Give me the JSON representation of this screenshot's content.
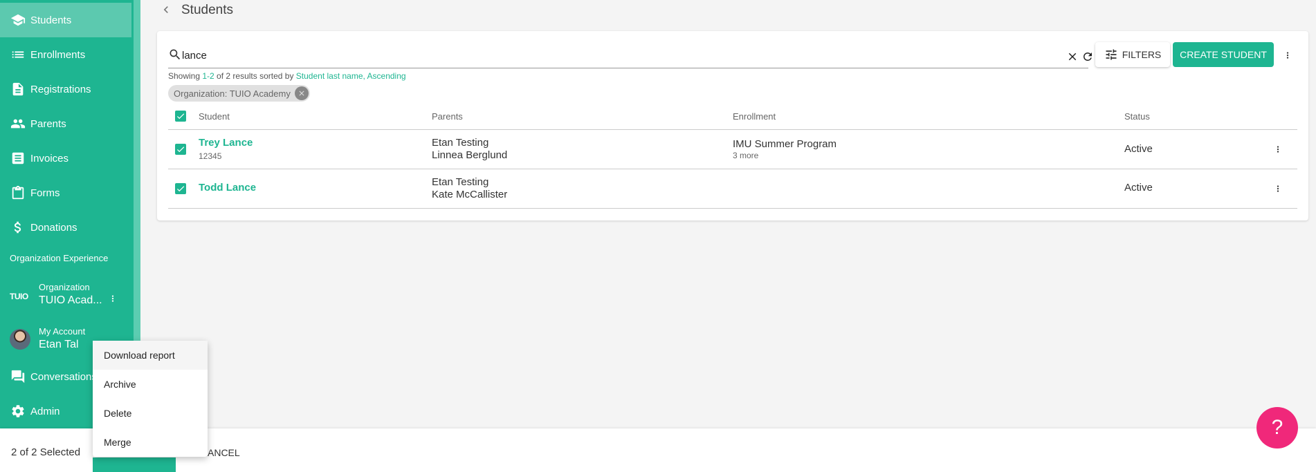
{
  "sidebar": {
    "items": [
      {
        "label": "Students",
        "icon": "graduation-cap-icon"
      },
      {
        "label": "Enrollments",
        "icon": "list-icon"
      },
      {
        "label": "Registrations",
        "icon": "document-icon"
      },
      {
        "label": "Parents",
        "icon": "people-icon"
      },
      {
        "label": "Invoices",
        "icon": "invoice-icon"
      },
      {
        "label": "Forms",
        "icon": "clipboard-icon"
      },
      {
        "label": "Donations",
        "icon": "dollar-icon"
      }
    ],
    "section_label": "Organization Experience",
    "org": {
      "logo": "TUIO",
      "sub": "Organization",
      "name": "TUIO Acad..."
    },
    "account": {
      "sub": "My Account",
      "name": "Etan Tal"
    },
    "bottom_items": [
      {
        "label": "Conversations",
        "icon": "chat-icon"
      },
      {
        "label": "Admin",
        "icon": "gear-icon"
      }
    ],
    "accent": "#1eb591"
  },
  "header": {
    "title": "Students"
  },
  "search": {
    "value": "lance",
    "placeholder": ""
  },
  "toolbar": {
    "filters_label": "FILTERS",
    "create_label": "CREATE STUDENT"
  },
  "results": {
    "prefix": "Showing ",
    "range": "1-2",
    "middle": " of 2 results sorted by ",
    "sort_field": "Student last name",
    "sep": ", ",
    "sort_dir": "Ascending"
  },
  "chip": {
    "label": "Organization: TUIO Academy"
  },
  "table": {
    "columns": [
      "Student",
      "Parents",
      "Enrollment",
      "Status"
    ],
    "rows": [
      {
        "name": "Trey Lance",
        "id": "12345",
        "parents": [
          "Etan Testing",
          "Linnea Berglund"
        ],
        "enrollment": "IMU Summer Program",
        "enrollment_more": "3 more",
        "status": "Active"
      },
      {
        "name": "Todd Lance",
        "id": "",
        "parents": [
          "Etan Testing",
          "Kate McCallister"
        ],
        "enrollment": "",
        "enrollment_more": "",
        "status": "Active"
      }
    ]
  },
  "bottom_bar": {
    "selected": "2 of 2 Selected",
    "cancel_label": "ANCEL"
  },
  "menu": {
    "items": [
      "Download report",
      "Archive",
      "Delete",
      "Merge"
    ]
  },
  "help": {
    "label": "?"
  },
  "colors": {
    "accent": "#1eb591",
    "help": "#f0287a"
  }
}
